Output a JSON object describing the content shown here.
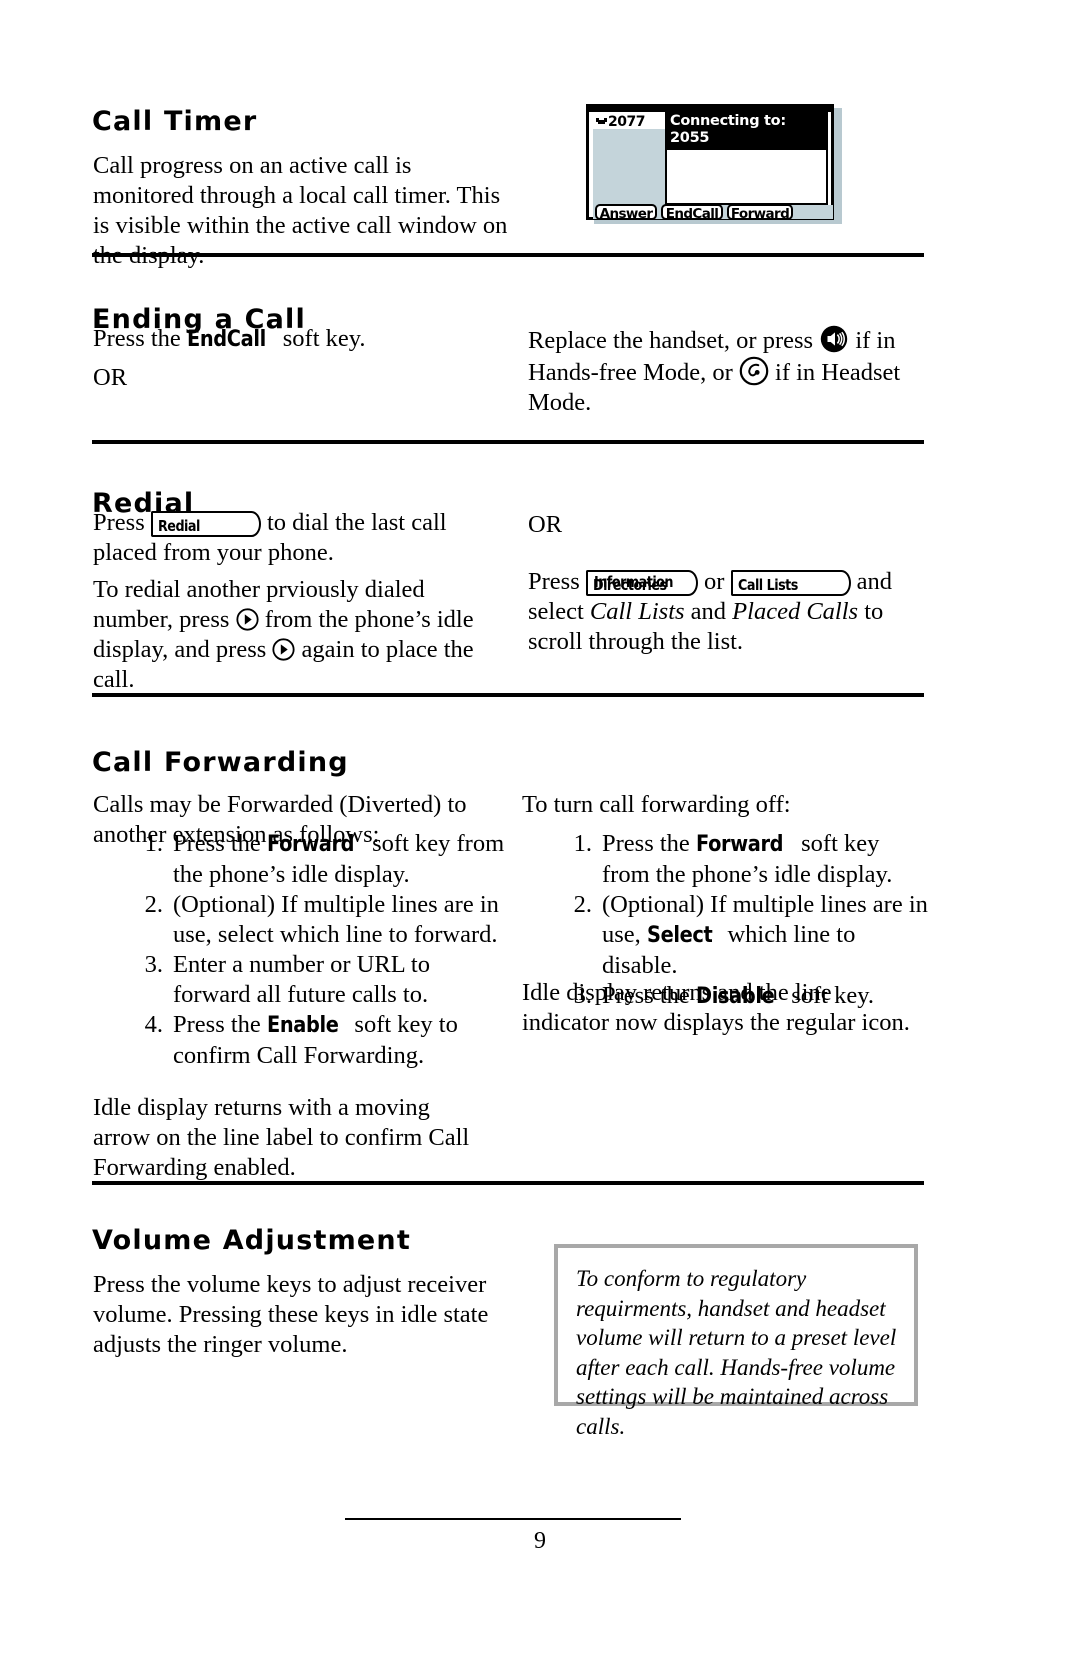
{
  "page": {
    "number": "9"
  },
  "sections": {
    "call_timer": {
      "title": "Call Timer",
      "body": "Call progress on an active call is monitored through a local call timer.  This is visible within the active call window on the display.",
      "figure": {
        "name": "active-call-lcd-screen",
        "line_label": "2077",
        "line_icon": "handset-icon",
        "call_status": "Connecting to:",
        "call_number": "2055",
        "softkeys": [
          "Answer",
          "EndCall",
          "Forward"
        ],
        "colors": {
          "panel": "#c4d4da",
          "callbox": "#000000",
          "frame": "#000000"
        }
      }
    },
    "ending_a_call": {
      "title": "Ending a Call",
      "left": {
        "press_prefix": "Press the ",
        "softkey": "EndCall",
        "press_suffix": " soft key.",
        "or": "OR"
      },
      "right": {
        "part1": "Replace the handset, or press ",
        "speaker_icon": "speakerphone-icon",
        "part2": " if in Hands-free Mode, or ",
        "headset_icon": "headset-icon",
        "part3": " if in Headset Mode."
      }
    },
    "redial": {
      "title": "Redial",
      "left": {
        "press_prefix": "Press ",
        "key_label": "Redial",
        "press_suffix": " to dial the last call placed from your phone.",
        "para2_part1": "To redial another prviously dialed number, press ",
        "scroll_icon_1": "right-arrow-key-icon",
        "para2_part2": " from the phone’s idle display, and press ",
        "scroll_icon_2": "right-arrow-key-icon",
        "para2_part3": " again to place the call."
      },
      "right": {
        "or": "OR",
        "press_prefix": "Press ",
        "key_label_1": "Directories",
        "key_label_1_overstrike": "Information",
        "or_mid": " or ",
        "key_label_2": "Call Lists",
        "press_suffix": " and select ",
        "italic_1": "Call Lists",
        "and": " and ",
        "italic_2": "Placed Calls",
        "tail": " to scroll through the list."
      }
    },
    "call_forwarding": {
      "title": "Call Forwarding",
      "left": {
        "intro": "Calls may be Forwarded (Diverted) to another extension as follows:",
        "steps": [
          {
            "num": "1.",
            "pre": "Press the ",
            "key": "Forward",
            "post": " soft key from the phone’s idle display."
          },
          {
            "num": "2.",
            "pre": "(Optional) If multiple lines are in use, select which line to forward.",
            "key": "",
            "post": ""
          },
          {
            "num": "3.",
            "pre": "Enter a number or URL to forward all future calls to.",
            "key": "",
            "post": ""
          },
          {
            "num": "4.",
            "pre": "Press the ",
            "key": "Enable",
            "post": " soft key to confirm Call Forwarding."
          }
        ],
        "outro": "Idle display returns with a moving arrow on the line label to confirm Call Forwarding enabled."
      },
      "right": {
        "intro": "To turn call forwarding off:",
        "steps": [
          {
            "num": "1.",
            "pre": "Press the ",
            "key": "Forward",
            "post": " soft key from the phone’s idle display."
          },
          {
            "num": "2.",
            "pre": "(Optional) If multiple lines are in use, ",
            "key": "Select",
            "post": " which line to disable."
          },
          {
            "num": "3.",
            "pre": "Press the ",
            "key": "Disable",
            "post": " soft key."
          }
        ],
        "outro": "Idle display returns and the line indicator now displays the regular icon."
      }
    },
    "volume_adjustment": {
      "title": "Volume Adjustment",
      "body": "Press the volume keys to adjust receiver volume.  Pressing these keys in idle state adjusts the ringer volume.",
      "note": "To conform to regulatory requirments, handset and headset volume will return to a preset level after each call.  Hands-free volume settings will be maintained across calls.",
      "note_border_color": "#a8a8a8"
    }
  }
}
